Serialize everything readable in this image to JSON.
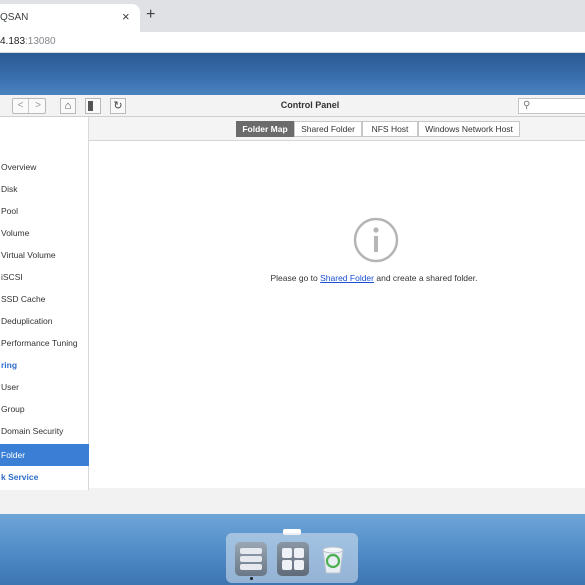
{
  "browser": {
    "tab_title": "QSAN",
    "tab_close": "×",
    "new_tab": "+",
    "url_host": "4.183",
    "url_port": ":13080"
  },
  "window": {
    "title": "Control Panel",
    "back": "<",
    "forward": ">",
    "search_placeholder": "",
    "search_icon": "search-icon"
  },
  "sidebar": {
    "items": [
      {
        "label": "Overview",
        "type": "item"
      },
      {
        "label": "Disk",
        "type": "item"
      },
      {
        "label": "Pool",
        "type": "item"
      },
      {
        "label": "Volume",
        "type": "item"
      },
      {
        "label": "Virtual Volume",
        "type": "item"
      },
      {
        "label": "iSCSI",
        "type": "item"
      },
      {
        "label": "SSD Cache",
        "type": "item"
      },
      {
        "label": "Deduplication",
        "type": "item"
      },
      {
        "label": "Performance Tuning",
        "type": "item"
      },
      {
        "label": "ring",
        "type": "category"
      },
      {
        "label": "User",
        "type": "item"
      },
      {
        "label": "Group",
        "type": "item"
      },
      {
        "label": "Domain Security",
        "type": "item"
      },
      {
        "label": "Folder",
        "type": "active"
      },
      {
        "label": "k Service",
        "type": "category"
      }
    ]
  },
  "content": {
    "tabs": [
      {
        "label": "Folder Map",
        "active": true
      },
      {
        "label": "Shared Folder",
        "active": false
      },
      {
        "label": "NFS Host",
        "active": false
      },
      {
        "label": "Windows Network Host",
        "active": false
      }
    ],
    "message_prefix": "Please go to ",
    "message_link": "Shared Folder",
    "message_suffix": " and create a shared folder."
  },
  "dock": {
    "apps": [
      "storage-manager-app",
      "app-center",
      "recycle-bin"
    ]
  },
  "colors": {
    "accent": "#3a7fd5",
    "category": "#2d6bc9",
    "active_tab": "#6b6b6b"
  }
}
